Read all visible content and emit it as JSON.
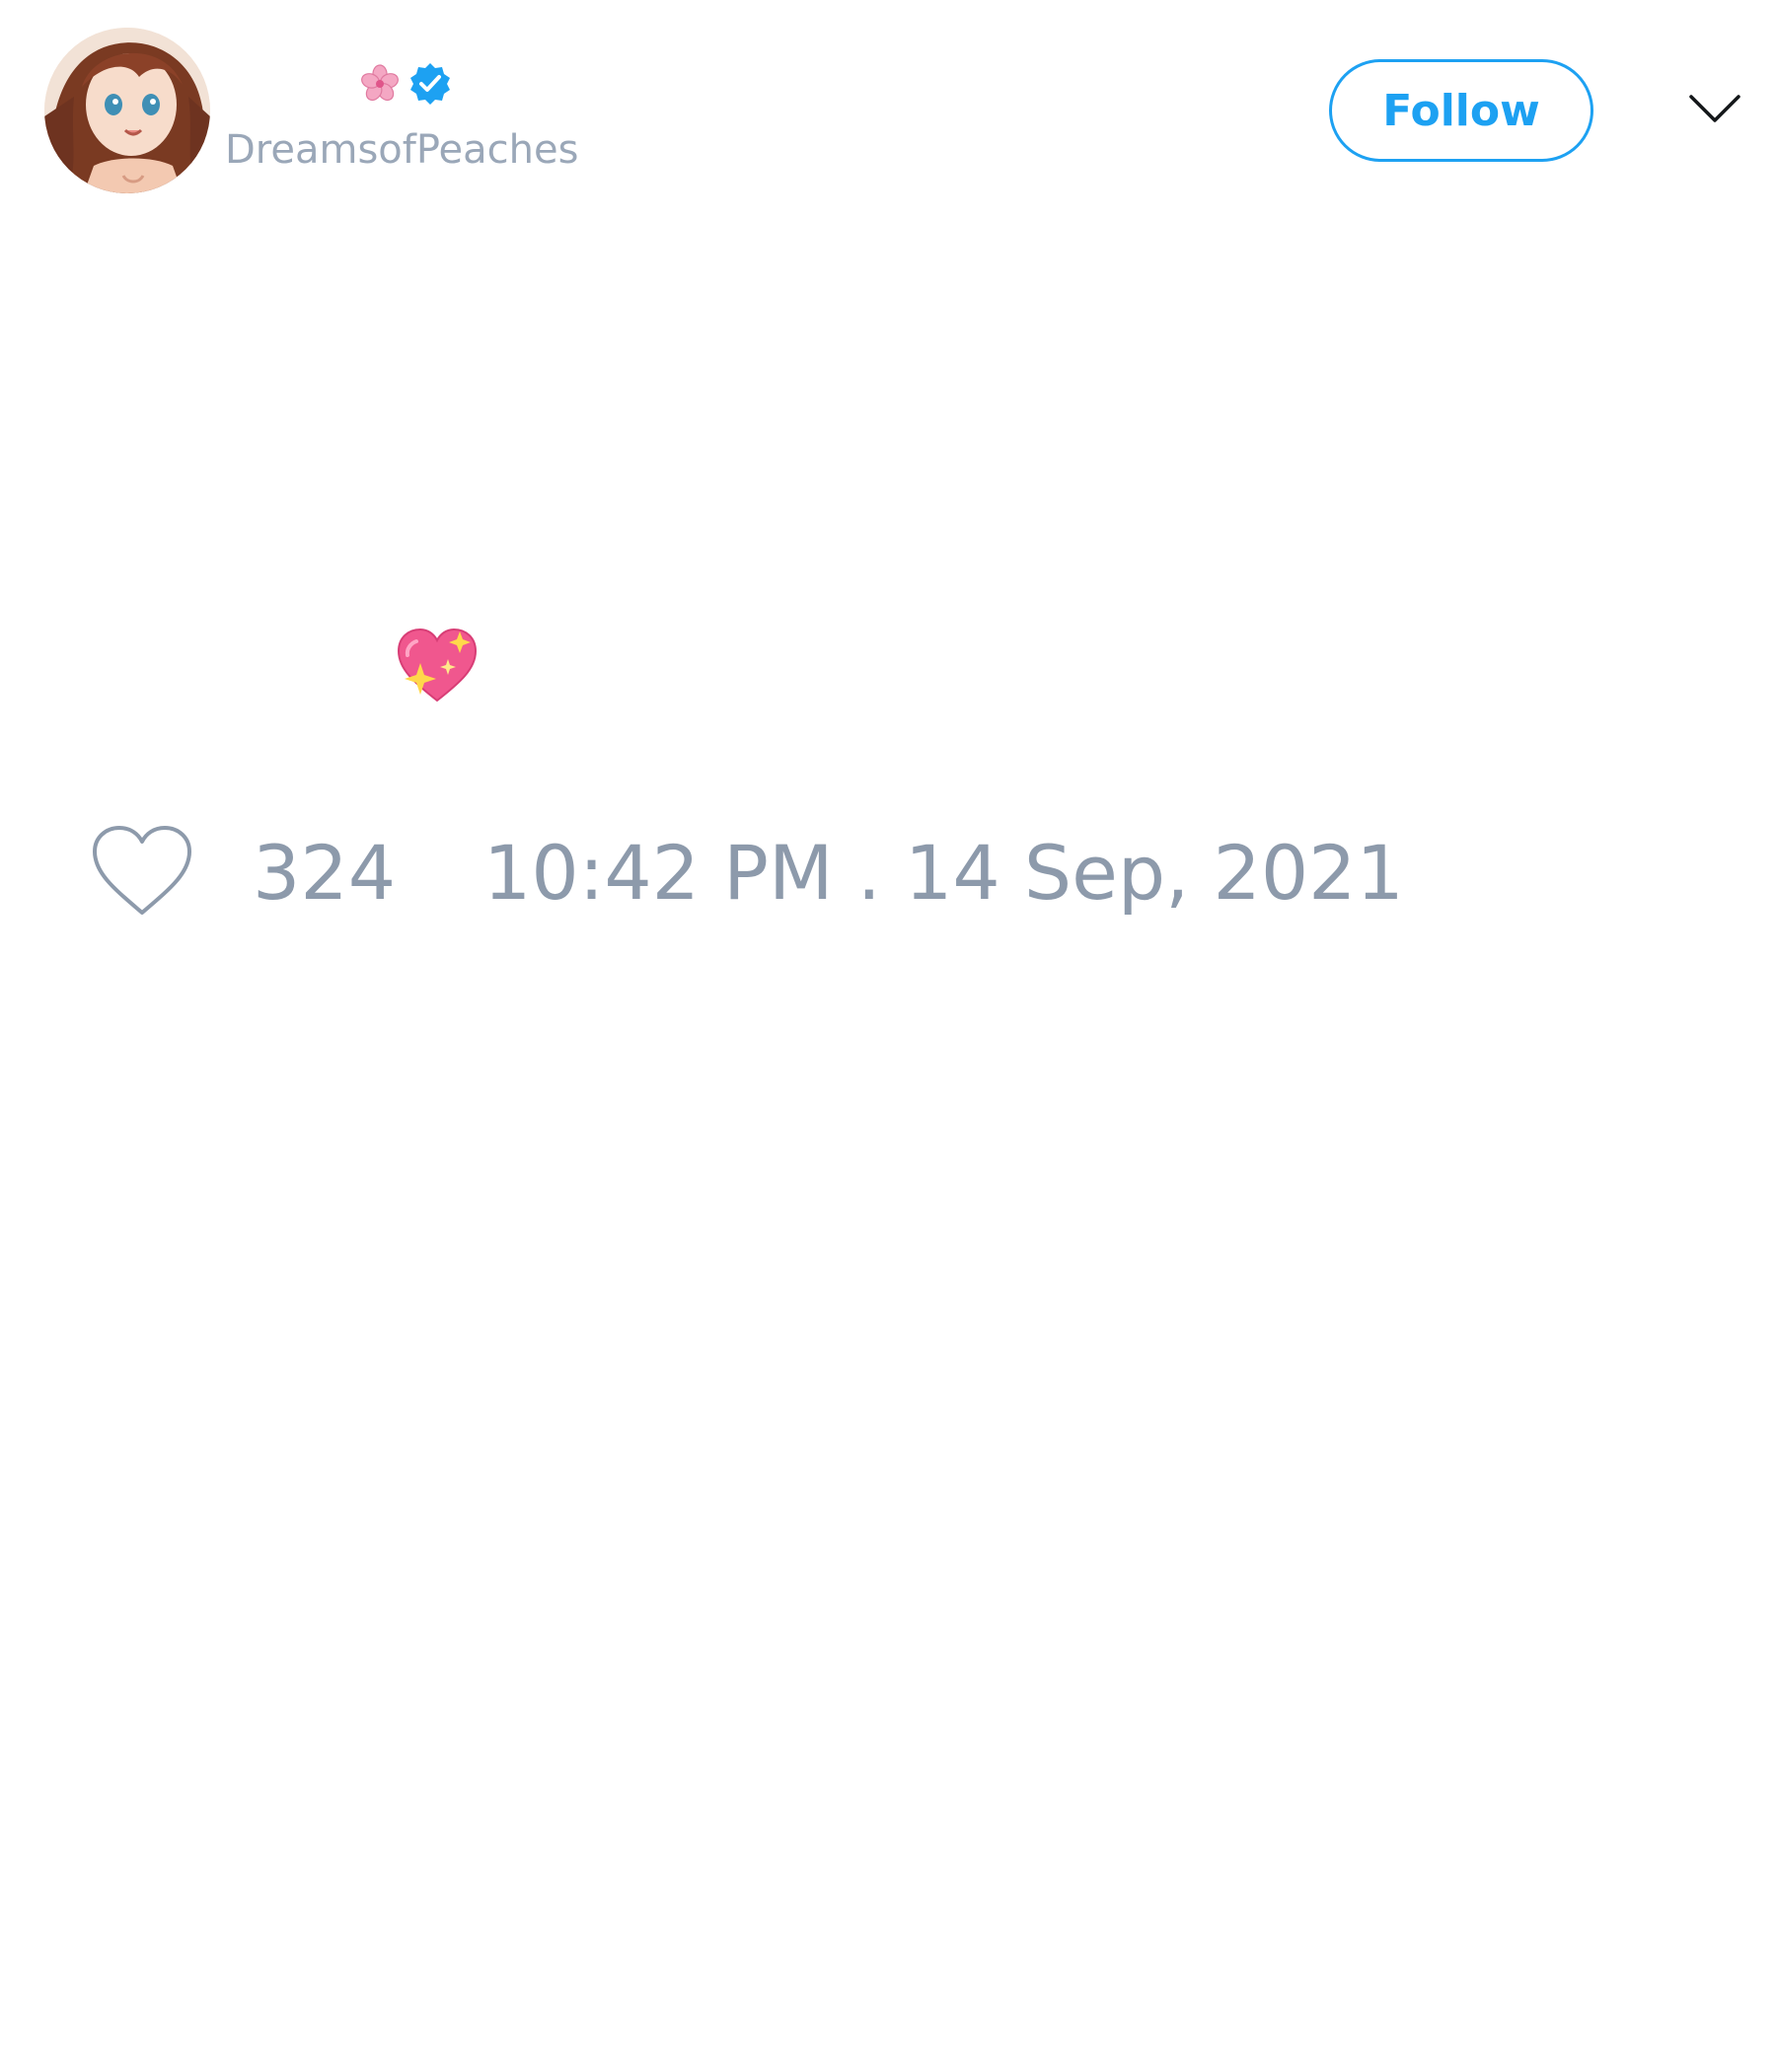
{
  "tweet": {
    "author": {
      "display_name": "",
      "handle": "DreamsofPeaches",
      "verified": true,
      "name_emoji": "cherry-blossom-icon",
      "avatar": "anime-avatar"
    },
    "follow_button_label": "Follow",
    "menu_icon": "chevron-down-icon",
    "text": "",
    "text_emoji": "sparkling-heart-icon",
    "like_icon": "heart-outline-icon",
    "like_count": "324",
    "timestamp": "10:42 PM . 14 Sep, 2021"
  },
  "colors": {
    "accent": "#1da1f2",
    "muted_text": "#8d9aab",
    "handle_text": "#9aa7b8"
  }
}
